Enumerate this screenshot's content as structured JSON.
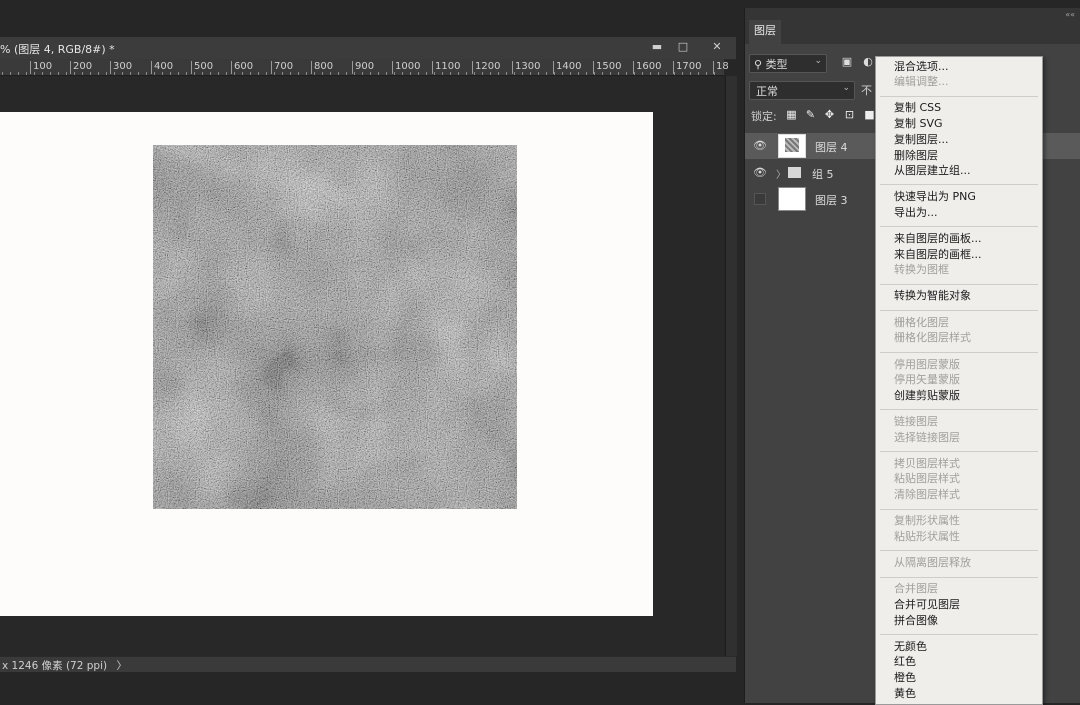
{
  "document": {
    "title": "% (图层 4, RGB/8#) *",
    "ruler_ticks": [
      "100",
      "200",
      "300",
      "400",
      "500",
      "600",
      "700",
      "800",
      "900",
      "1000",
      "1100",
      "1200",
      "1300",
      "1400",
      "1500",
      "1600",
      "1700",
      "18"
    ],
    "status": "x 1246 像素 (72 ppi)",
    "status_chevron": "〉"
  },
  "window_controls": {
    "minimize": "▬",
    "restore": "□",
    "close": "✕"
  },
  "layers_panel": {
    "tab": "图层",
    "filter_kind": "类型",
    "blend_mode": "正常",
    "opacity_label": "不",
    "lock_label": "锁定:",
    "layers": [
      {
        "name": "图层 4",
        "visible": true,
        "type": "pixel"
      },
      {
        "name": "组 5",
        "visible": true,
        "type": "group"
      },
      {
        "name": "图层 3",
        "visible": false,
        "type": "pixel"
      }
    ]
  },
  "context_menu": {
    "items": [
      {
        "label": "混合选项...",
        "enabled": true
      },
      {
        "label": "编辑调整...",
        "enabled": false
      },
      {
        "label": "复制 CSS",
        "enabled": true
      },
      {
        "label": "复制 SVG",
        "enabled": true
      },
      {
        "label": "复制图层...",
        "enabled": true
      },
      {
        "label": "删除图层",
        "enabled": true
      },
      {
        "label": "从图层建立组...",
        "enabled": true
      },
      {
        "label": "快速导出为 PNG",
        "enabled": true
      },
      {
        "label": "导出为...",
        "enabled": true
      },
      {
        "label": "来自图层的画板...",
        "enabled": true
      },
      {
        "label": "来自图层的画框...",
        "enabled": true
      },
      {
        "label": "转换为图框",
        "enabled": false
      },
      {
        "label": "转换为智能对象",
        "enabled": true
      },
      {
        "label": "栅格化图层",
        "enabled": false
      },
      {
        "label": "栅格化图层样式",
        "enabled": false
      },
      {
        "label": "停用图层蒙版",
        "enabled": false
      },
      {
        "label": "停用矢量蒙版",
        "enabled": false
      },
      {
        "label": "创建剪贴蒙版",
        "enabled": true
      },
      {
        "label": "链接图层",
        "enabled": false
      },
      {
        "label": "选择链接图层",
        "enabled": false
      },
      {
        "label": "拷贝图层样式",
        "enabled": false
      },
      {
        "label": "粘贴图层样式",
        "enabled": false
      },
      {
        "label": "清除图层样式",
        "enabled": false
      },
      {
        "label": "复制形状属性",
        "enabled": false
      },
      {
        "label": "粘贴形状属性",
        "enabled": false
      },
      {
        "label": "从隔离图层释放",
        "enabled": false
      },
      {
        "label": "合并图层",
        "enabled": false
      },
      {
        "label": "合并可见图层",
        "enabled": true
      },
      {
        "label": "拼合图像",
        "enabled": true
      },
      {
        "label": "无颜色",
        "enabled": true
      },
      {
        "label": "红色",
        "enabled": true
      },
      {
        "label": "橙色",
        "enabled": true
      },
      {
        "label": "黄色",
        "enabled": true
      }
    ]
  }
}
